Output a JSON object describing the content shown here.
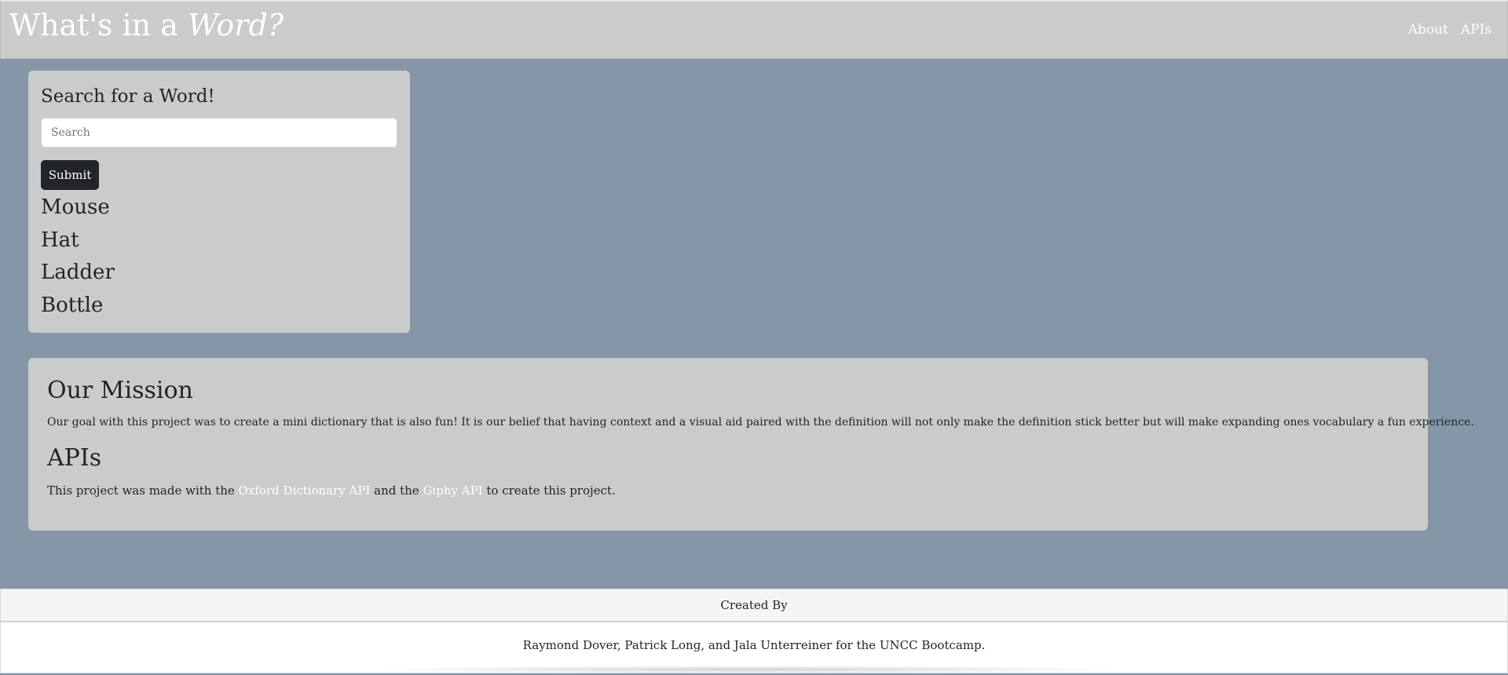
{
  "header": {
    "brand_prefix": "What's in a ",
    "brand_emphasis": "Word?",
    "nav": [
      {
        "label": "About"
      },
      {
        "label": "APIs"
      }
    ]
  },
  "search": {
    "title": "Search for a Word!",
    "placeholder": "Search",
    "value": "",
    "submit_label": "Submit",
    "words": [
      "Mouse",
      "Hat",
      "Ladder",
      "Bottle"
    ]
  },
  "mission": {
    "title": "Our Mission",
    "text": "Our goal with this project was to create a mini dictionary that is also fun! It is our belief that having context and a visual aid paired with the definition will not only make the definition stick better but will make expanding ones vocabulary a fun experience.",
    "apis_title": "APIs",
    "apis_text_before": "This project was made with the ",
    "apis_link1": "Oxford Dictionary API",
    "apis_text_middle": " and the ",
    "apis_link2": "Giphy API",
    "apis_text_after": " to create this project."
  },
  "footer": {
    "header": "Created By",
    "body": "Raymond Dover, Patrick Long, and Jala Unterreiner for the UNCC Bootcamp."
  },
  "colors": {
    "page_background": "#8596a8",
    "card_background": "#cbcbcb",
    "button_background": "#212529",
    "link_color": "#ffffff"
  }
}
